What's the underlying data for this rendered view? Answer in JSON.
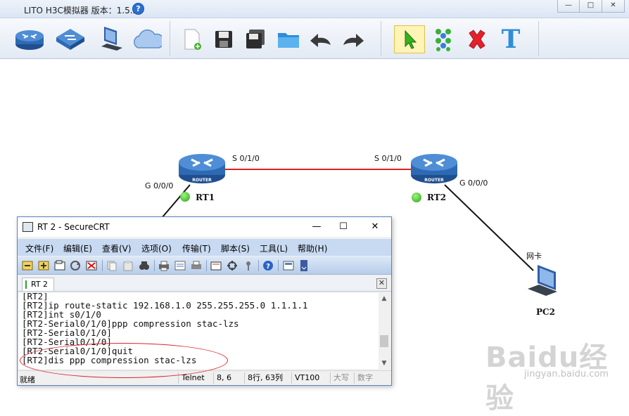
{
  "app": {
    "title": "LITO H3C模拟器 版本：1.5.2",
    "help_glyph": "?",
    "window_controls": [
      "—",
      "□",
      "✕"
    ]
  },
  "toolbar": {
    "device_tools": [
      "router-icon",
      "switch-icon",
      "pc-icon",
      "cloud-icon"
    ],
    "file_tools": [
      "new-file-icon",
      "save-icon",
      "save-as-icon",
      "open-folder-icon",
      "undo-icon",
      "redo-icon"
    ],
    "edit_tools": [
      "select-arrow-icon",
      "connect-icon",
      "delete-icon",
      "text-icon"
    ],
    "text_tool_glyph": "T"
  },
  "topology": {
    "rt1": {
      "name": "RT1",
      "router_label": "ROUTER",
      "port_left": "G 0/0/0",
      "port_right": "S 0/1/0"
    },
    "rt2": {
      "name": "RT2",
      "router_label": "ROUTER",
      "port_left": "S 0/1/0",
      "port_right": "G 0/0/0"
    },
    "pc2": {
      "name": "PC2",
      "nic_label": "网卡"
    },
    "link_color": "#e02020"
  },
  "securecrt": {
    "title": "RT 2 - SecureCRT",
    "controls": [
      "—",
      "☐",
      "✕"
    ],
    "menu": [
      "文件(F)",
      "编辑(E)",
      "查看(V)",
      "选项(O)",
      "传输(T)",
      "脚本(S)",
      "工具(L)",
      "帮助(H)"
    ],
    "tab": "RT 2",
    "tab_close": "✕",
    "lines": [
      "[RT2]",
      "[RT2]ip route-static 192.168.1.0 255.255.255.0 1.1.1.1",
      "[RT2]int s0/1/0",
      "[RT2-Serial0/1/0]ppp compression stac-lzs",
      "[RT2-Serial0/1/0]",
      "[RT2-Serial0/1/0]",
      "[RT2-Serial0/1/0]quit",
      "[RT2]dis ppp compression stac-lzs"
    ],
    "status": {
      "ready": "就绪",
      "protocol": "Telnet",
      "cursor": "8,  6",
      "rowcol": "8行, 63列",
      "term": "VT100",
      "caps": "大写",
      "num": "数字"
    }
  },
  "watermark": {
    "text": "Baidu经验",
    "url": "jingyan.baidu.com"
  }
}
